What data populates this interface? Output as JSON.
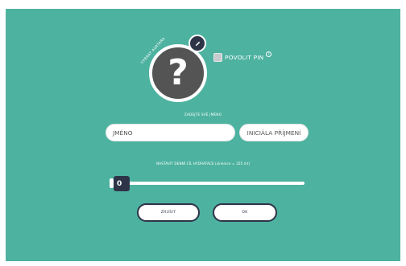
{
  "dialog": {
    "avatar": {
      "choose_label": "VYBRAT AVATARA",
      "placeholder_glyph": "?",
      "edit_icon": "pencil-icon"
    },
    "pin": {
      "label": "POVOLIT PIN",
      "checked": false,
      "help_glyph": "?"
    },
    "name_section": {
      "caption": "ZADEJTE SVÉ JMÉNO",
      "first_name_placeholder": "JMÉNO",
      "initial_placeholder": "INICIÁLA PŘÍJMENÍ"
    },
    "hydration": {
      "caption": "NASTAVIT DENNÍ CÍL HYDRATACE (sklenice = 355 ml)",
      "value": "0",
      "level": 0
    },
    "buttons": {
      "cancel_label": "ZRUŠIT",
      "ok_label": "OK"
    },
    "colors": {
      "background": "#4db2a0",
      "accent_dark": "#2e3448",
      "avatar_fill": "#545454"
    }
  }
}
